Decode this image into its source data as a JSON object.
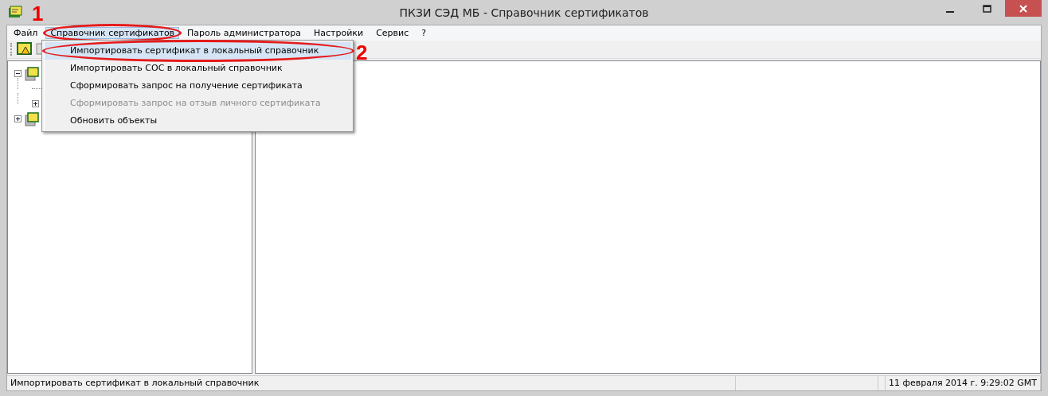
{
  "window": {
    "title": "ПКЗИ СЭД МБ - Справочник сертификатов"
  },
  "menu": [
    {
      "label": "Файл",
      "selected": false
    },
    {
      "label": "Справочник сертификатов",
      "selected": true
    },
    {
      "label": "Пароль администратора",
      "selected": false
    },
    {
      "label": "Настройки",
      "selected": false
    },
    {
      "label": "Сервис",
      "selected": false
    },
    {
      "label": "?",
      "selected": false
    }
  ],
  "dropdown": [
    {
      "label": "Импортировать сертификат в локальный справочник",
      "selected": true,
      "disabled": false
    },
    {
      "label": "Импортировать СОС в локальный справочник",
      "selected": false,
      "disabled": false
    },
    {
      "label": "Сформировать запрос на получение сертификата",
      "selected": false,
      "disabled": false
    },
    {
      "label": "Сформировать запрос на отзыв личного сертификата",
      "selected": false,
      "disabled": true
    },
    {
      "label": "Обновить объекты",
      "selected": false,
      "disabled": false
    }
  ],
  "tree": [
    {
      "kind": "branch",
      "expanded": true,
      "children": [
        {
          "kind": "leaf"
        },
        {
          "kind": "branch",
          "expanded": false
        }
      ]
    },
    {
      "kind": "branch",
      "expanded": false
    }
  ],
  "annotations": [
    "1",
    "2"
  ],
  "status_bar": {
    "message": "Импортировать сертификат в локальный справочник",
    "datetime": "11 февраля 2014 г. 9:29:02 GMT"
  }
}
